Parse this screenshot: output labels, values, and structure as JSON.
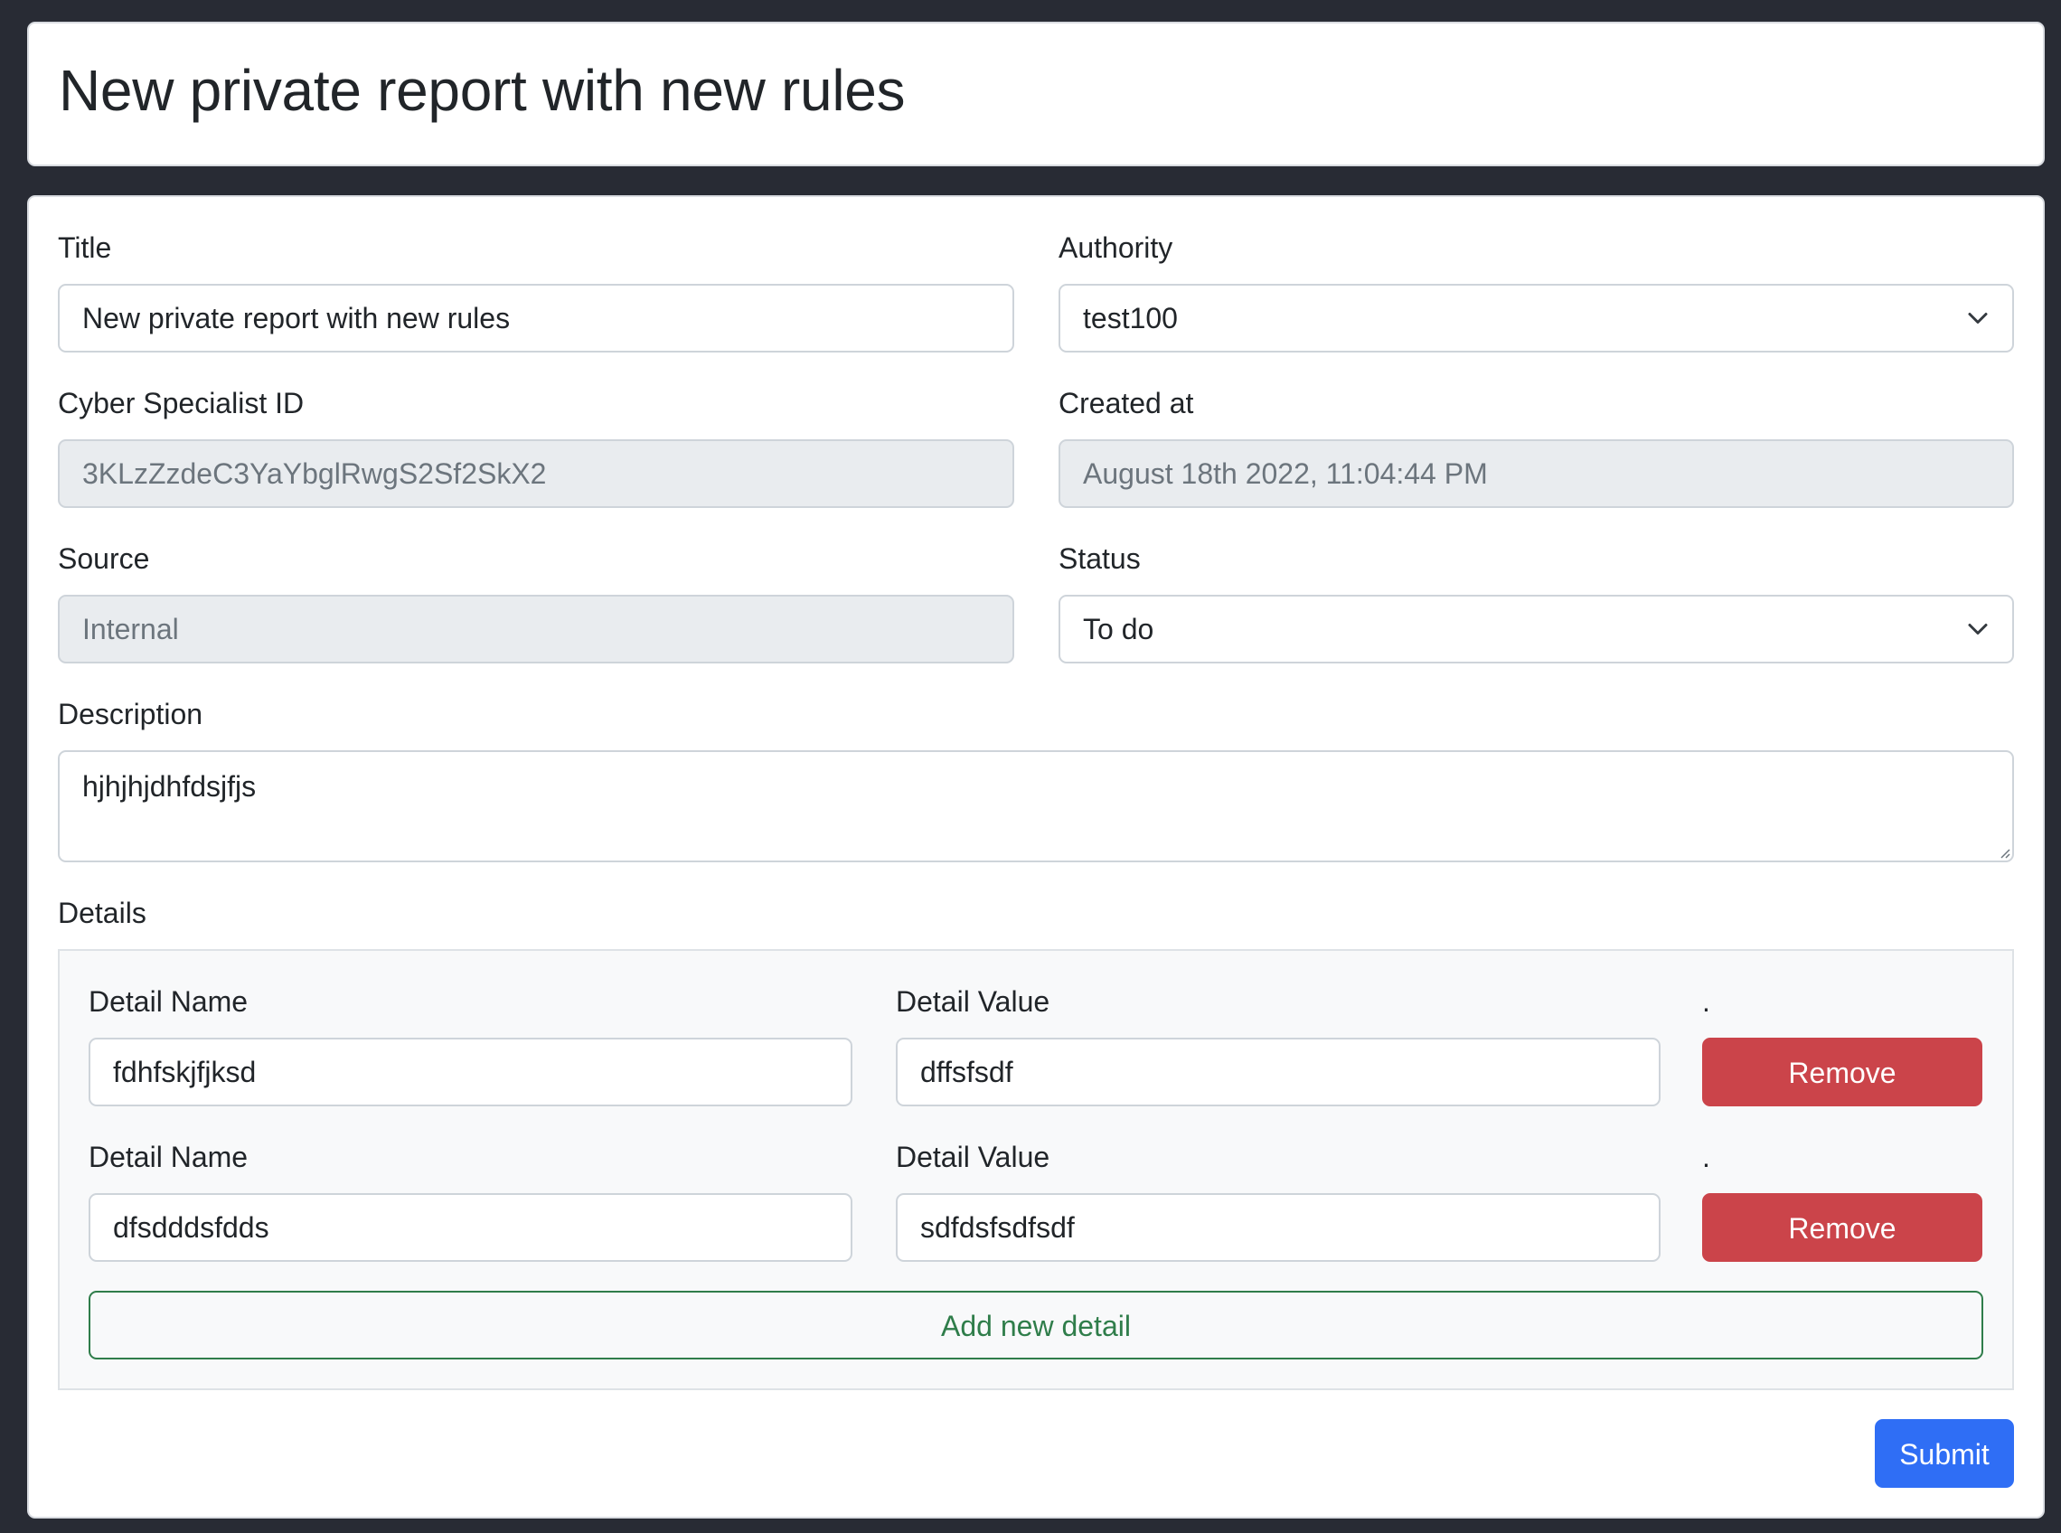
{
  "header": {
    "title": "New private report with new rules"
  },
  "form": {
    "title": {
      "label": "Title",
      "value": "New private report with new rules"
    },
    "authority": {
      "label": "Authority",
      "selected": "test100"
    },
    "cyber_specialist_id": {
      "label": "Cyber Specialist ID",
      "value": "3KLzZzdeC3YaYbglRwgS2Sf2SkX2"
    },
    "created_at": {
      "label": "Created at",
      "value": "August 18th 2022, 11:04:44 PM"
    },
    "source": {
      "label": "Source",
      "value": "Internal"
    },
    "status": {
      "label": "Status",
      "selected": "To do"
    },
    "description": {
      "label": "Description",
      "value": "hjhjhjdhfdsjfjs"
    },
    "details": {
      "label": "Details",
      "rows": [
        {
          "name_label": "Detail Name",
          "name_value": "fdhfskjfjksd",
          "value_label": "Detail Value",
          "value_value": "dffsfsdf",
          "action_label": ".",
          "remove_label": "Remove"
        },
        {
          "name_label": "Detail Name",
          "name_value": "dfsdddsfdds",
          "value_label": "Detail Value",
          "value_value": "sdfdsfsdfsdf",
          "action_label": ".",
          "remove_label": "Remove"
        }
      ],
      "add_label": "Add new detail"
    },
    "submit_label": "Submit"
  },
  "colors": {
    "page_background": "#282b34",
    "danger": "#cb444a",
    "success": "#2f7d4a",
    "primary": "#2f6ef5",
    "disabled_field": "#e9ecef"
  },
  "icons": {
    "select_indicator": "chevron-down-icon",
    "textarea_resize": "resize-grip-icon"
  }
}
